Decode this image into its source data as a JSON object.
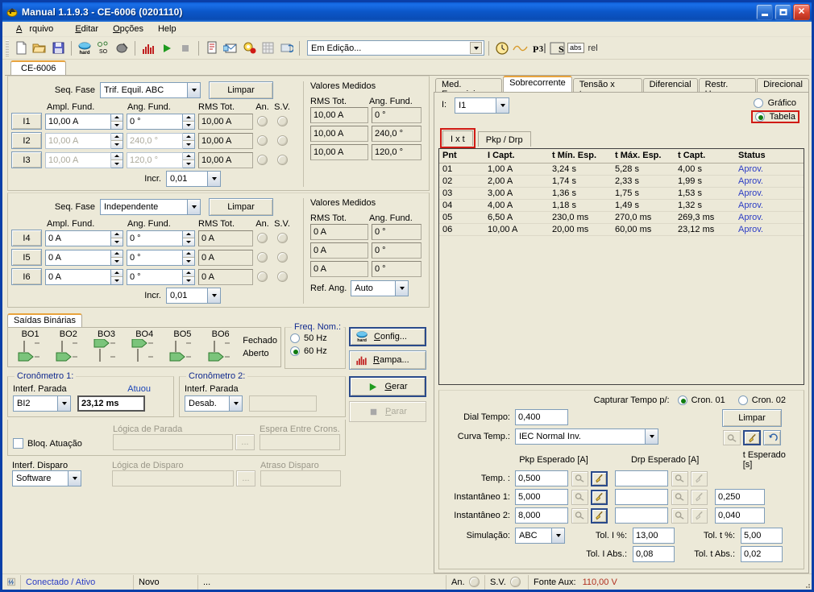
{
  "window": {
    "title": "Manual 1.1.9.3 - CE-6006 (0201110)",
    "icon": "app-icon",
    "minimize": "–",
    "maximize": "□",
    "close": "✕"
  },
  "menu": [
    "Arquivo",
    "Editar",
    "Opções",
    "Help"
  ],
  "toolbar": {
    "icons": [
      "new-file-icon",
      "open-folder-icon",
      "save-disk-icon",
      "hardware-icon",
      "so-network-icon",
      "antenna-icon",
      "bar-chart-icon",
      "play-icon",
      "stop-icon",
      "report-icon",
      "mail-report-icon",
      "settings-alert-icon",
      "matrix-icon",
      "refresh-icon"
    ],
    "status_combo": "Em Edição...",
    "right_icons": [
      "clock-icon",
      "sine-wave-icon",
      "p3-icon",
      "s-icon"
    ],
    "abs_label": "abs",
    "rel_label": "rel"
  },
  "app_tab": "CE-6006",
  "left": {
    "group1": {
      "seq_label": "Seq. Fase",
      "seq_value": "Trif. Equil. ABC",
      "clear_button": "Limpar",
      "measured_title": "Valores Medidos",
      "headers": {
        "ampl": "Ampl. Fund.",
        "ang": "Ang. Fund.",
        "rms": "RMS Tot.",
        "an": "An.",
        "sv": "S.V.",
        "m_rms": "RMS Tot.",
        "m_ang": "Ang. Fund."
      },
      "rows": [
        {
          "ch": "I1",
          "ampl": "10,00 A",
          "ang": "0 °",
          "rms": "10,00 A",
          "m_rms": "10,00 A",
          "m_ang": "0 °",
          "enabled": true
        },
        {
          "ch": "I2",
          "ampl": "10,00 A",
          "ang": "240,0 °",
          "rms": "10,00 A",
          "m_rms": "10,00 A",
          "m_ang": "240,0 °",
          "enabled": false
        },
        {
          "ch": "I3",
          "ampl": "10,00 A",
          "ang": "120,0 °",
          "rms": "10,00 A",
          "m_rms": "10,00 A",
          "m_ang": "120,0 °",
          "enabled": false
        }
      ],
      "incr_label": "Incr.",
      "incr_value": "0,01"
    },
    "group2": {
      "seq_label": "Seq. Fase",
      "seq_value": "Independente",
      "clear_button": "Limpar",
      "measured_title": "Valores Medidos",
      "headers": {
        "ampl": "Ampl. Fund.",
        "ang": "Ang. Fund.",
        "rms": "RMS Tot.",
        "an": "An.",
        "sv": "S.V.",
        "m_rms": "RMS Tot.",
        "m_ang": "Ang. Fund."
      },
      "rows": [
        {
          "ch": "I4",
          "ampl": "0 A",
          "ang": "0 °",
          "rms": "0 A",
          "m_rms": "0 A",
          "m_ang": "0 °",
          "enabled": true
        },
        {
          "ch": "I5",
          "ampl": "0 A",
          "ang": "0 °",
          "rms": "0 A",
          "m_rms": "0 A",
          "m_ang": "0 °",
          "enabled": true
        },
        {
          "ch": "I6",
          "ampl": "0 A",
          "ang": "0 °",
          "rms": "0 A",
          "m_rms": "0 A",
          "m_ang": "0 °",
          "enabled": true
        }
      ],
      "incr_label": "Incr.",
      "incr_value": "0,01",
      "refang_label": "Ref. Ang.",
      "refang_value": "Auto"
    },
    "binary": {
      "tab_label": "Saídas Binárias",
      "outputs": [
        {
          "name": "BO1",
          "state": "aberto"
        },
        {
          "name": "BO2",
          "state": "aberto"
        },
        {
          "name": "BO3",
          "state": "fechado"
        },
        {
          "name": "BO4",
          "state": "fechado"
        },
        {
          "name": "BO5",
          "state": "aberto"
        },
        {
          "name": "BO6",
          "state": "aberto"
        }
      ],
      "closed_label": "Fechado",
      "open_label": "Aberto"
    },
    "freq": {
      "title": "Freq. Nom.:",
      "options": [
        "50 Hz",
        "60 Hz"
      ],
      "selected": "60 Hz"
    },
    "buttons": {
      "config": "Config...",
      "rampa": "Rampa...",
      "gerar": "Gerar",
      "parar": "Parar"
    },
    "chrono1": {
      "title": "Cronômetro 1:",
      "interf_label": "Interf. Parada",
      "interf_value": "BI2",
      "atuou_label": "Atuou",
      "atuou_value": "23,12 ms"
    },
    "chrono2": {
      "title": "Cronômetro 2:",
      "interf_label": "Interf. Parada",
      "interf_value": "Desab.",
      "atuou_value": ""
    },
    "block": {
      "checkbox_label": "Bloq. Atuação",
      "stop_logic_label": "Lógica de Parada",
      "stop_logic_value": "",
      "dots_button": "...",
      "wait_label": "Espera Entre Crons.",
      "wait_value": ""
    },
    "trigger": {
      "interf_label": "Interf. Disparo",
      "interf_value": "Software",
      "logic_label": "Lógica de Disparo",
      "logic_value": "",
      "dots_button": "...",
      "delay_label": "Atraso Disparo",
      "delay_value": ""
    }
  },
  "right": {
    "tabs": [
      "Med. Especiais",
      "Sobrecorrente",
      "Tensão x tempo",
      "Diferencial",
      "Restr. Harm.",
      "Direcional"
    ],
    "active_tab": "Sobrecorrente",
    "current_label": "I:",
    "current_value": "I1",
    "view_options": [
      "Gráfico",
      "Tabela"
    ],
    "view_selected": "Tabela",
    "subtabs": [
      "I x t",
      "Pkp / Drp"
    ],
    "active_subtab": "I x t",
    "table": {
      "headers": [
        "Pnt",
        "I Capt.",
        "t Mín. Esp.",
        "t Máx. Esp.",
        "t Capt.",
        "Status"
      ],
      "rows": [
        [
          "01",
          "1,00 A",
          "3,24 s",
          "5,28 s",
          "4,00 s",
          "Aprov."
        ],
        [
          "02",
          "2,00 A",
          "1,74 s",
          "2,33 s",
          "1,99 s",
          "Aprov."
        ],
        [
          "03",
          "3,00 A",
          "1,36 s",
          "1,75 s",
          "1,53 s",
          "Aprov."
        ],
        [
          "04",
          "4,00 A",
          "1,18 s",
          "1,49 s",
          "1,32 s",
          "Aprov."
        ],
        [
          "05",
          "6,50 A",
          "230,0 ms",
          "270,0 ms",
          "269,3 ms",
          "Aprov."
        ],
        [
          "06",
          "10,00 A",
          "20,00 ms",
          "60,00 ms",
          "23,12 ms",
          "Aprov."
        ]
      ]
    },
    "settings": {
      "capture_label": "Capturar Tempo p/:",
      "capture_options": [
        "Cron. 01",
        "Cron. 02"
      ],
      "capture_selected": "Cron. 01",
      "dial_label": "Dial Tempo:",
      "dial_value": "0,400",
      "curve_label": "Curva Temp.:",
      "curve_value": "IEC Normal Inv.",
      "clear_button": "Limpar",
      "col_pkp": "Pkp Esperado [A]",
      "col_drp": "Drp Esperado [A]",
      "col_t": "t Esperado [s]",
      "rows": [
        {
          "label": "Temp. :",
          "pkp": "0,500",
          "drp": "",
          "t": ""
        },
        {
          "label": "Instantâneo 1:",
          "pkp": "5,000",
          "drp": "",
          "t": "0,250"
        },
        {
          "label": "Instantâneo 2:",
          "pkp": "8,000",
          "drp": "",
          "t": "0,040"
        }
      ],
      "sim_label": "Simulação:",
      "sim_value": "ABC",
      "tol_i_pct_label": "Tol. I %:",
      "tol_i_pct_value": "13,00",
      "tol_i_abs_label": "Tol. I Abs.:",
      "tol_i_abs_value": "0,08",
      "tol_t_pct_label": "Tol. t %:",
      "tol_t_pct_value": "5,00",
      "tol_t_abs_label": "Tol. t Abs.:",
      "tol_t_abs_value": "0,02"
    }
  },
  "statusbar": {
    "connection": "Conectado / Ativo",
    "file": "Novo",
    "extra": "...",
    "an_label": "An.",
    "sv_label": "S.V.",
    "aux_label": "Fonte Aux:",
    "aux_value": "110,00 V"
  },
  "colors": {
    "accent_blue": "#0a4cb4",
    "highlight_red": "#d01b15",
    "status_link": "#2b3cc4",
    "aux_value": "#b03020",
    "face": "#ece9d8",
    "group_label": "#10298e"
  }
}
